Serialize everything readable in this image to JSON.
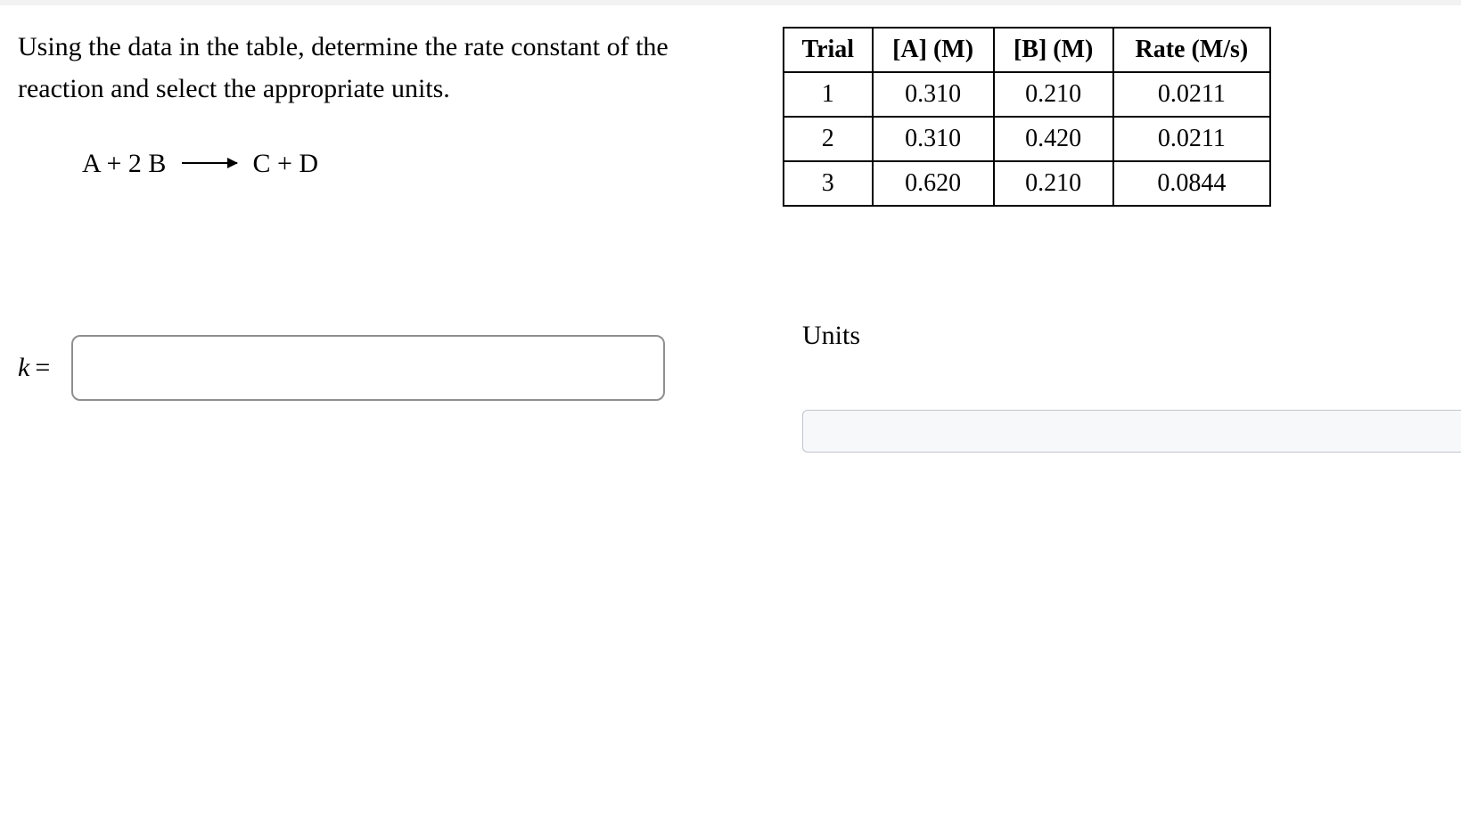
{
  "prompt": "Using the data in the table, determine the rate constant of the reaction and select the appropriate units.",
  "equation": {
    "lhs": "A + 2 B",
    "rhs": "C + D"
  },
  "table": {
    "headers": [
      "Trial",
      "[A] (M)",
      "[B] (M)",
      "Rate (M/s)"
    ],
    "rows": [
      [
        "1",
        "0.310",
        "0.210",
        "0.0211"
      ],
      [
        "2",
        "0.310",
        "0.420",
        "0.0211"
      ],
      [
        "3",
        "0.620",
        "0.210",
        "0.0844"
      ]
    ]
  },
  "answer": {
    "k_symbol": "k",
    "eq": "=",
    "k_value": "",
    "units_label": "Units",
    "units_value": ""
  }
}
